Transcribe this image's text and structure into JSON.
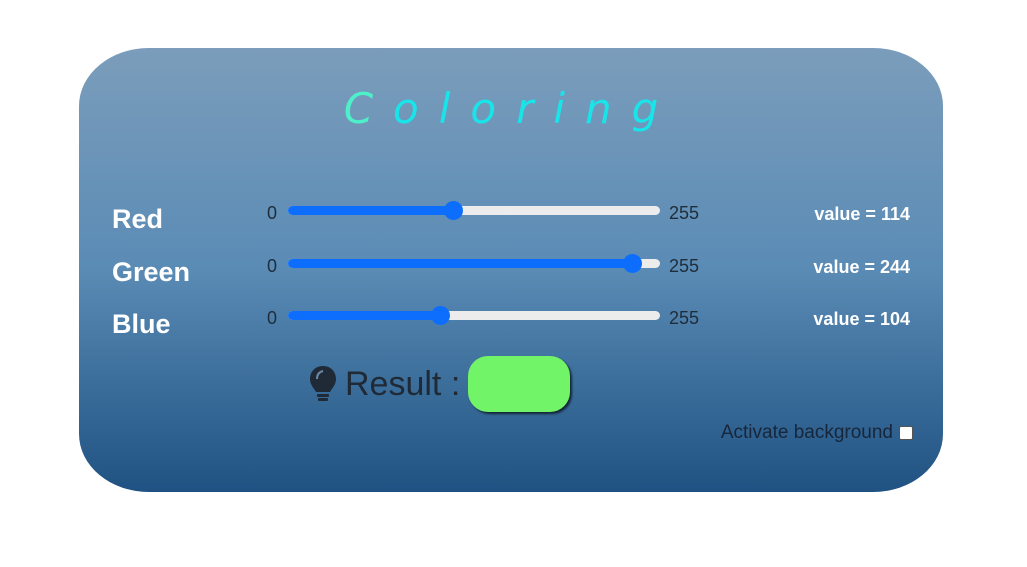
{
  "app": {
    "title": "Coloring"
  },
  "sliders": [
    {
      "label": "Red",
      "min_label": "0",
      "max_label": "255",
      "value": 114,
      "value_text": "value = 114"
    },
    {
      "label": "Green",
      "min_label": "0",
      "max_label": "255",
      "value": 244,
      "value_text": "value = 244"
    },
    {
      "label": "Blue",
      "min_label": "0",
      "max_label": "255",
      "value": 104,
      "value_text": "value = 104"
    }
  ],
  "slider_range": {
    "min": 0,
    "max": 255
  },
  "result": {
    "label": "Result :",
    "icon": "lightbulb-icon",
    "color": "#72f468"
  },
  "background_toggle": {
    "label": "Activate background",
    "checked": false
  },
  "colors": {
    "accent": "#0d6efd",
    "title": "#18e5ea"
  }
}
